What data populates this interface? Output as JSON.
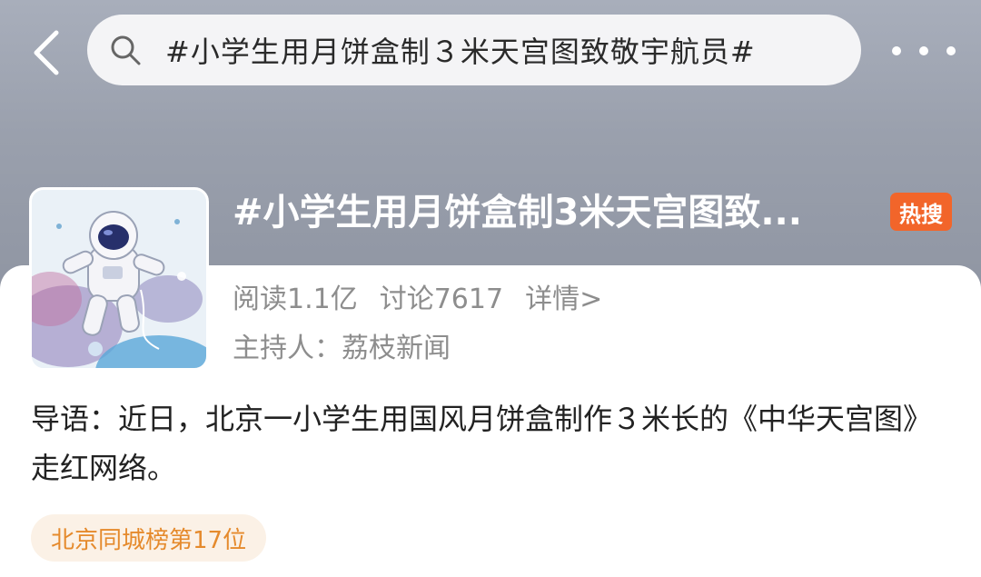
{
  "nav": {
    "back_icon": "chevron-left-icon",
    "search_icon": "search-icon",
    "more_icon": "more-dots-icon"
  },
  "search": {
    "query": "#小学生用月饼盒制３米天宫图致敬宇航员#"
  },
  "topic": {
    "title": "#小学生用月饼盒制3米天宫图致...",
    "hot_badge": "热搜",
    "reads": "阅读1.1亿",
    "discussions": "讨论7617",
    "details_link": "详情>",
    "host": "主持人：荔枝新闻",
    "thumbnail_subject": "astronaut-illustration"
  },
  "intro": {
    "text": "导语：近日，北京一小学生用国风月饼盒制作３米长的《中华天宫图》走红网络。"
  },
  "rank": {
    "label": "北京同城榜第17位"
  },
  "colors": {
    "header_bg": "#9aa0ad",
    "hot_badge": "#f2652a",
    "rank_text": "#e58a2c",
    "rank_bg": "#fbf1e6"
  }
}
